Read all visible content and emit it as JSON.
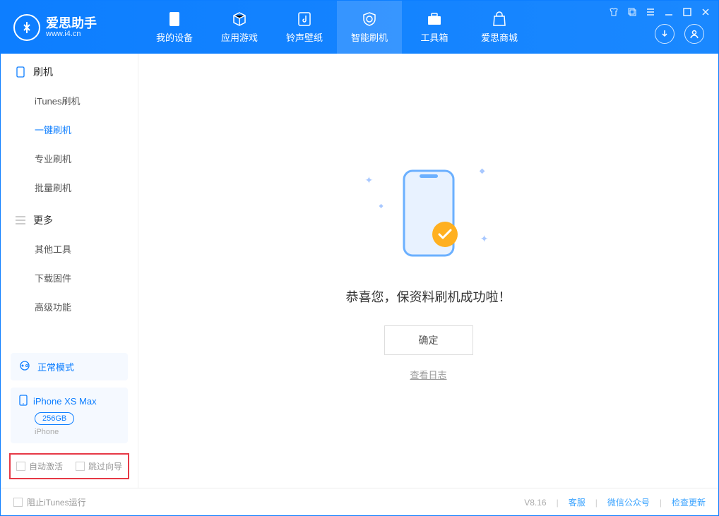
{
  "app": {
    "title": "爱思助手",
    "subtitle": "www.i4.cn"
  },
  "tabs": [
    {
      "label": "我的设备"
    },
    {
      "label": "应用游戏"
    },
    {
      "label": "铃声壁纸"
    },
    {
      "label": "智能刷机"
    },
    {
      "label": "工具箱"
    },
    {
      "label": "爱思商城"
    }
  ],
  "sidebar": {
    "group1": {
      "title": "刷机",
      "items": [
        "iTunes刷机",
        "一键刷机",
        "专业刷机",
        "批量刷机"
      ]
    },
    "group2": {
      "title": "更多",
      "items": [
        "其他工具",
        "下载固件",
        "高级功能"
      ]
    }
  },
  "mode": {
    "label": "正常模式"
  },
  "device": {
    "name": "iPhone XS Max",
    "storage": "256GB",
    "type": "iPhone"
  },
  "checks": {
    "auto_activate": "自动激活",
    "skip_guide": "跳过向导"
  },
  "main": {
    "success_msg": "恭喜您，保资料刷机成功啦！",
    "confirm": "确定",
    "view_log": "查看日志"
  },
  "footer": {
    "block_itunes": "阻止iTunes运行",
    "version": "V8.16",
    "links": [
      "客服",
      "微信公众号",
      "检查更新"
    ]
  }
}
